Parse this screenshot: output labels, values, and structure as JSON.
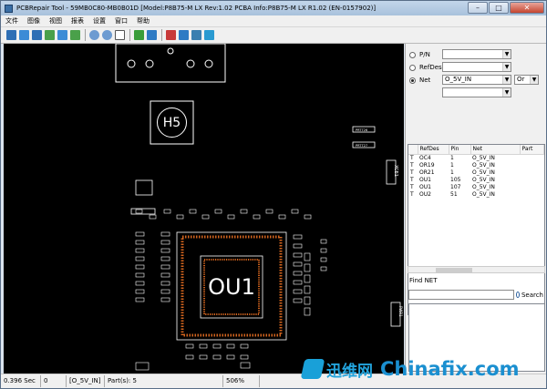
{
  "window": {
    "title": "PCBRepair Tool - 59MB0C80-MB0B01D [Model:P8B75-M LX Rev:1.02 PCBA Info:P8B75-M LX R1.02 (EN-0157902)]",
    "min": "–",
    "max": "□",
    "close": "✕"
  },
  "menu": [
    "文件",
    "图像",
    "视图",
    "报表",
    "设置",
    "窗口",
    "帮助"
  ],
  "toolbar": {
    "icons": [
      "zoom-fit-icon",
      "rotate-icon",
      "mirror-icon",
      "flip-icon",
      "layer-icon",
      "up-icon",
      "zoom-in-icon",
      "zoom-out-icon",
      "pointer-icon",
      "bom-icon",
      "part-icon",
      "net-icon",
      "board-icon",
      "print-icon",
      "export-icon"
    ]
  },
  "colors": {
    "board": "#000000",
    "component": "#ffffff",
    "accent": "#d2641e"
  },
  "canvas": {
    "h5_label": "H5",
    "ou1_label": "OU1",
    "prt_a": "PRT726",
    "prt_b": "PRT727",
    "xce_label": "XCE1",
    "right_label": "PWR1"
  },
  "filter": {
    "pn_label": "P/N",
    "refdes_label": "RefDes",
    "net_label": "Net",
    "net_value": "O_5V_IN",
    "or_value": "Or"
  },
  "grid": {
    "headers": [
      "RefDes",
      "Pin",
      "Net",
      "Part"
    ],
    "rows": [
      {
        "t": "T",
        "ref": "OC4",
        "pin": "1",
        "net": "O_5V_IN"
      },
      {
        "t": "T",
        "ref": "OR19",
        "pin": "1",
        "net": "O_5V_IN"
      },
      {
        "t": "T",
        "ref": "OR21",
        "pin": "1",
        "net": "O_5V_IN"
      },
      {
        "t": "T",
        "ref": "OU1",
        "pin": "105",
        "net": "O_5V_IN"
      },
      {
        "t": "T",
        "ref": "OU1",
        "pin": "107",
        "net": "O_5V_IN"
      },
      {
        "t": "T",
        "ref": "OU2",
        "pin": "51",
        "net": "O_5V_IN"
      }
    ]
  },
  "find": {
    "label": "Find NET",
    "search_label": "Search"
  },
  "status": {
    "time": "0.396 Sec",
    "count": "0",
    "net": "[O_5V_IN]",
    "parts": "Part(s):  5",
    "zoom": "506%"
  },
  "watermark": {
    "cn": "迅维网",
    "en": "Chinafix.com"
  }
}
